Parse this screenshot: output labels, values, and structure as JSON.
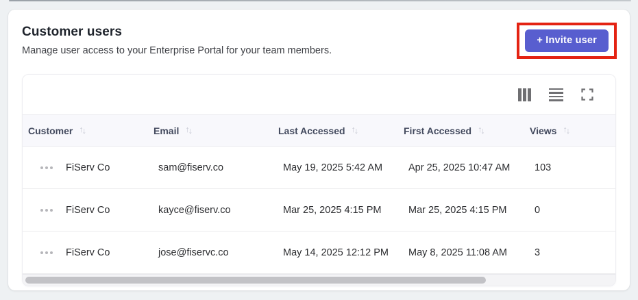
{
  "page": {
    "title": "Customer users",
    "subtitle": "Manage user access to your Enterprise Portal for your team members."
  },
  "invite_button": {
    "label": "+ Invite user"
  },
  "annotation": {
    "type": "highlight-rectangle",
    "color": "#e42313"
  },
  "colors": {
    "button_accent": "#585ecf",
    "highlight_red": "#e42313",
    "header_row_bg": "#f8f8fc",
    "page_bg": "#eef1f3"
  },
  "toolbar": {
    "icons": [
      "columns-icon",
      "row-density-icon",
      "fullscreen-icon"
    ]
  },
  "table": {
    "sort_icon": {
      "up": "↑",
      "down": "↓"
    },
    "columns": [
      {
        "label": "Customer"
      },
      {
        "label": "Email"
      },
      {
        "label": "Last Accessed"
      },
      {
        "label": "First Accessed"
      },
      {
        "label": "Views"
      }
    ],
    "rows": [
      {
        "customer": "FiServ Co",
        "email": "sam@fiserv.co",
        "last_accessed": "May 19, 2025 5:42 AM",
        "first_accessed": "Apr 25, 2025 10:47 AM",
        "views": "103"
      },
      {
        "customer": "FiServ Co",
        "email": "kayce@fiserv.co",
        "last_accessed": "Mar 25, 2025 4:15 PM",
        "first_accessed": "Mar 25, 2025 4:15 PM",
        "views": "0"
      },
      {
        "customer": "FiServ Co",
        "email": "jose@fiservc.co",
        "last_accessed": "May 14, 2025 12:12 PM",
        "first_accessed": "May 8, 2025 11:08 AM",
        "views": "3"
      }
    ]
  }
}
